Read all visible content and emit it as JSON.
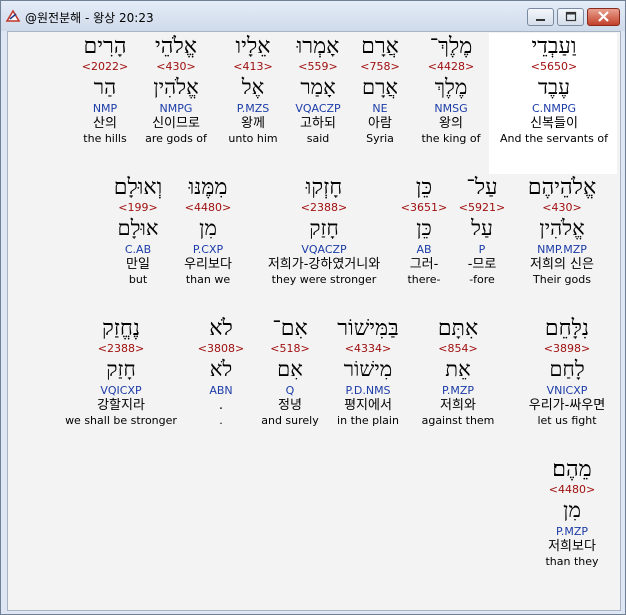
{
  "window": {
    "title": "@원전분해 - 왕상 20:23",
    "app_icon": "bible-app-icon",
    "controls": {
      "minimize": "minimize-icon",
      "maximize": "maximize-icon",
      "close": "close-icon"
    }
  },
  "words": [
    {
      "hebrew": "וַעַבְדֵי",
      "strong": "<5650>",
      "lemma": "עֶבֶד",
      "parse": "C.NMPG",
      "korean": "신복들이",
      "english": "And the servants of"
    },
    {
      "hebrew": "מֶלֶךְ־",
      "strong": "<4428>",
      "lemma": "מֶלֶךְ",
      "parse": "NMSG",
      "korean": "왕의",
      "english": "the king of"
    },
    {
      "hebrew": "אֲרָם",
      "strong": "<758>",
      "lemma": "אֲרָם",
      "parse": "NE",
      "korean": "아람",
      "english": "Syria"
    },
    {
      "hebrew": "אָמְרוּ",
      "strong": "<559>",
      "lemma": "אָמַר",
      "parse": "VQACZP",
      "korean": "고하되",
      "english": "said"
    },
    {
      "hebrew": "אֵלָיו",
      "strong": "<413>",
      "lemma": "אֶל",
      "parse": "P.MZS",
      "korean": "왕께",
      "english": "unto him"
    },
    {
      "hebrew": "אֱלֹהֵי",
      "strong": "<430>",
      "lemma": "אֱלֹהִין",
      "parse": "NMPG",
      "korean": "신이므로",
      "english": "are gods of"
    },
    {
      "hebrew": "הָרִים",
      "strong": "<2022>",
      "lemma": "הַר",
      "parse": "NMP",
      "korean": "산의",
      "english": "the hills"
    },
    {
      "hebrew": "אֱלֹהֵיהֶם",
      "strong": "<430>",
      "lemma": "אֱלֹהִין",
      "parse": "NMP.MZP",
      "korean": "저희의 신은",
      "english": "Their gods"
    },
    {
      "hebrew": "עַל־",
      "strong": "<5921>",
      "lemma": "עַל",
      "parse": "P",
      "korean": "-므로",
      "english": "-fore"
    },
    {
      "hebrew": "כֵּן",
      "strong": "<3651>",
      "lemma": "כֵּן",
      "parse": "AB",
      "korean": "그러-",
      "english": "there-"
    },
    {
      "hebrew": "חָזְקוּ",
      "strong": "<2388>",
      "lemma": "חָזַק",
      "parse": "VQACZP",
      "korean": "저희가-강하였거니와",
      "english": "they were stronger"
    },
    {
      "hebrew": "מִמֶּנּוּ",
      "strong": "<4480>",
      "lemma": "מִן",
      "parse": "P.CXP",
      "korean": "우리보다",
      "english": "than we"
    },
    {
      "hebrew": "וְאוּלָם",
      "strong": "<199>",
      "lemma": "אוּלָם",
      "parse": "C.AB",
      "korean": "만일",
      "english": "but"
    },
    {
      "hebrew": "נִלָּחֵם",
      "strong": "<3898>",
      "lemma": "לָחַם",
      "parse": "VNICXP",
      "korean": "우리가-싸우면",
      "english": "let us fight"
    },
    {
      "hebrew": "אִתָּם",
      "strong": "<854>",
      "lemma": "אֵת",
      "parse": "P.MZP",
      "korean": "저희와",
      "english": "against them"
    },
    {
      "hebrew": "בַּמִּישׁוֹר",
      "strong": "<4334>",
      "lemma": "מִישׁוֹר",
      "parse": "P.D.NMS",
      "korean": "평지에서",
      "english": "in the plain"
    },
    {
      "hebrew": "אִם־",
      "strong": "<518>",
      "lemma": "אִם",
      "parse": "Q",
      "korean": "정녕",
      "english": "and surely"
    },
    {
      "hebrew": "לֹא",
      "strong": "<3808>",
      "lemma": "לֹא",
      "parse": "ABN",
      "korean": ".",
      "english": "."
    },
    {
      "hebrew": "נֶחֱזַק",
      "strong": "<2388>",
      "lemma": "חָזַק",
      "parse": "VQICXP",
      "korean": "강할지라",
      "english": "we shall be stronger"
    },
    {
      "hebrew": "מֵהֶם׃",
      "strong": "<4480>",
      "lemma": "מִן",
      "parse": "P.MZP",
      "korean": "저희보다",
      "english": "than they"
    }
  ]
}
